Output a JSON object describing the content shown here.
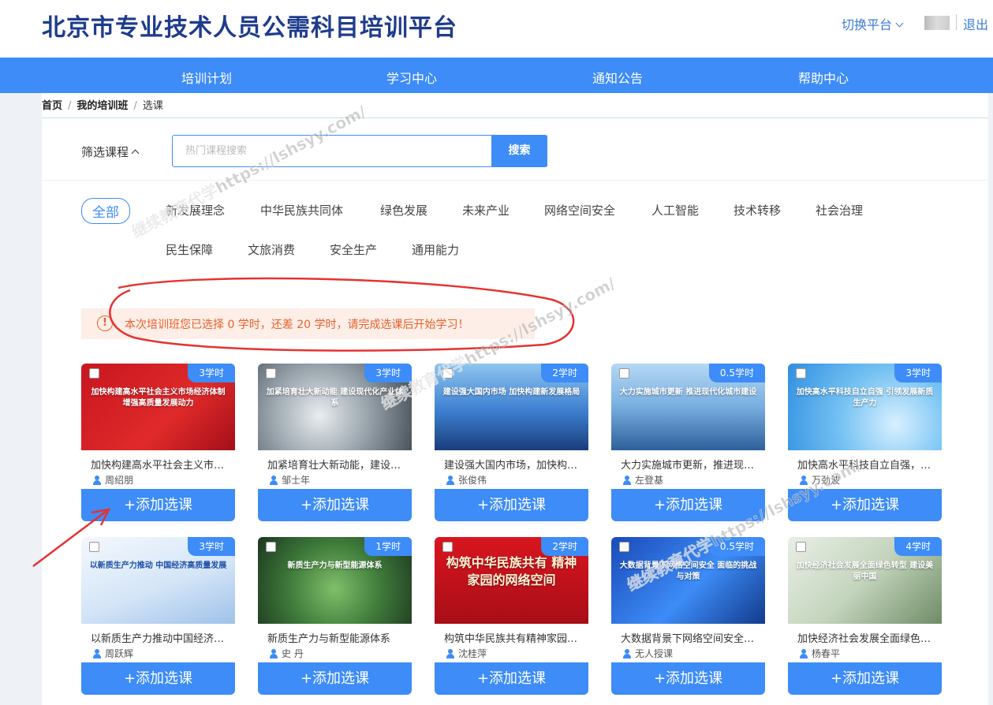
{
  "header": {
    "site_title": "北京市专业技术人员公需科目培训平台",
    "switch_platform": "切换平台",
    "logout": "退出"
  },
  "nav": [
    "培训计划",
    "学习中心",
    "通知公告",
    "帮助中心"
  ],
  "breadcrumb": {
    "home": "首页",
    "my_class": "我的培训班",
    "current": "选课",
    "separator": "/"
  },
  "filter": {
    "label": "筛选课程",
    "search_placeholder": "热门课程搜索",
    "search_button": "搜索"
  },
  "categories": [
    "全部",
    "新发展理念",
    "中华民族共同体",
    "绿色发展",
    "未来产业",
    "网络空间安全",
    "人工智能",
    "技术转移",
    "社会治理",
    "民生保障",
    "文旅消费",
    "安全生产",
    "通用能力"
  ],
  "notice": {
    "icon": "!",
    "text": "本次培训班您已选择 0 学时，还差 20 学时，请完成选课后开始学习！"
  },
  "add_button_label": "+添加选课",
  "courses": [
    {
      "hours": "3学时",
      "title": "加快构建高水平社会主义市场经济体制",
      "teacher": "周绍朋",
      "image_text": "加快构建高水平社会主义市场经济体制 增强高质量发展动力"
    },
    {
      "hours": "3学时",
      "title": "加紧培育壮大新动能，建设现代化产业体系",
      "teacher": "邹士年",
      "image_text": "加紧培育壮大新动能 建设现代化产业体系"
    },
    {
      "hours": "2学时",
      "title": "建设强大国内市场，加快构建新发展格局",
      "teacher": "张俊伟",
      "image_text": "建设强大国内市场 加快构建新发展格局"
    },
    {
      "hours": "0.5学时",
      "title": "大力实施城市更新，推进现代化城市建设",
      "teacher": "左登基",
      "image_text": "大力实施城市更新 推进现代化城市建设"
    },
    {
      "hours": "3学时",
      "title": "加快高水平科技自立自强，引领发展新质生产力",
      "teacher": "万劲波",
      "image_text": "加快高水平科技自立自强 引领发展新质生产力"
    },
    {
      "hours": "3学时",
      "title": "以新质生产力推动中国经济高质量发展",
      "teacher": "周跃辉",
      "image_text": "以新质生产力推动 中国经济高质量发展"
    },
    {
      "hours": "1学时",
      "title": "新质生产力与新型能源体系",
      "teacher": "史 丹",
      "image_text": "新质生产力与新型能源体系"
    },
    {
      "hours": "2学时",
      "title": "构筑中华民族共有精神家园的网络空间",
      "teacher": "沈桂萍",
      "image_text": "构筑中华民族共有 精神家园的网络空间"
    },
    {
      "hours": "0.5学时",
      "title": "大数据背景下网络空间安全面临的挑战与对策",
      "teacher": "无人授课",
      "image_text": "大数据背景下网络空间安全 面临的挑战与对策"
    },
    {
      "hours": "4学时",
      "title": "加快经济社会发展全面绿色转型，建设美丽中国",
      "teacher": "杨春平",
      "image_text": "加快经济社会发展全面绿色转型 建设美丽中国"
    }
  ],
  "watermarks": [
    "继续教育代学https://lshsyy.com/",
    "继续教育代学https://lshsyy.com/",
    "继续教育代学https://lshsyy.com/"
  ]
}
